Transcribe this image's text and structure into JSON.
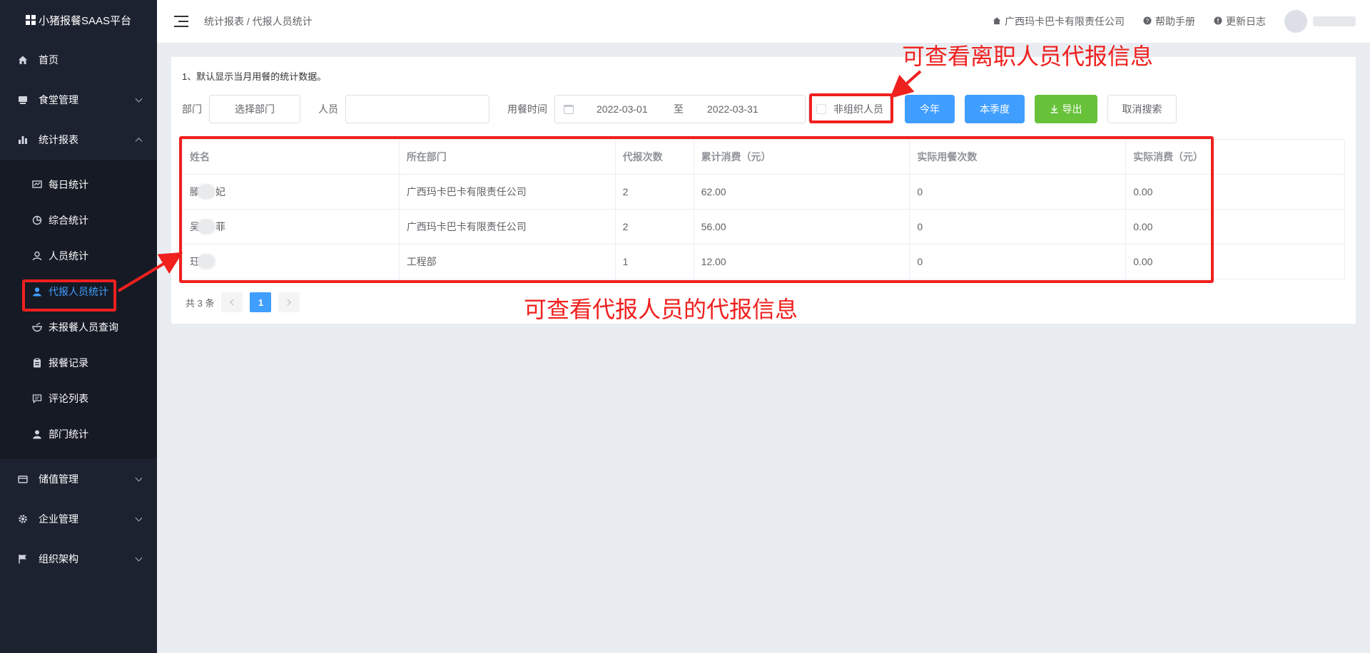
{
  "app": {
    "title": "小猪报餐SAAS平台"
  },
  "sidebar": {
    "items": [
      {
        "label": "首页",
        "icon": "home-icon"
      },
      {
        "label": "食堂管理",
        "icon": "canteen-icon"
      },
      {
        "label": "统计报表",
        "icon": "bar-chart-icon"
      }
    ],
    "sub_items": [
      {
        "label": "每日统计",
        "icon": "daily-stats-icon"
      },
      {
        "label": "综合统计",
        "icon": "pie-chart-icon"
      },
      {
        "label": "人员统计",
        "icon": "user-icon"
      },
      {
        "label": "代报人员统计",
        "icon": "user-filled-icon",
        "active": true
      },
      {
        "label": "未报餐人员查询",
        "icon": "bowl-icon"
      },
      {
        "label": "报餐记录",
        "icon": "clipboard-icon"
      },
      {
        "label": "评论列表",
        "icon": "comment-icon"
      },
      {
        "label": "部门统计",
        "icon": "user-group-icon"
      }
    ],
    "bottom_items": [
      {
        "label": "储值管理",
        "icon": "wallet-icon"
      },
      {
        "label": "企业管理",
        "icon": "gear-icon"
      },
      {
        "label": "组织架构",
        "icon": "flag-icon"
      }
    ]
  },
  "header": {
    "breadcrumb": "统计报表 / 代报人员统计",
    "company": "广西玛卡巴卡有限责任公司",
    "help": "帮助手册",
    "changelog": "更新日志"
  },
  "filters": {
    "tip": "1、默认显示当月用餐的统计数据。",
    "dept_label": "部门",
    "dept_button": "选择部门",
    "person_label": "人员",
    "person_value": "",
    "time_label": "用餐时间",
    "date_start": "2022-03-01",
    "date_sep": "至",
    "date_end": "2022-03-31",
    "checkbox_label": "非组织人员",
    "btn_year": "今年",
    "btn_quarter": "本季度",
    "btn_export": "导出",
    "btn_cancel": "取消搜索"
  },
  "table": {
    "headers": [
      "姓名",
      "所在部门",
      "代报次数",
      "累计消费（元）",
      "实际用餐次数",
      "实际消费（元）"
    ],
    "rows": [
      {
        "name_a": "滕",
        "name_b": "妃",
        "dept": "广西玛卡巴卡有限责任公司",
        "count": "2",
        "total": "62.00",
        "actual_count": "0",
        "actual_total": "0.00"
      },
      {
        "name_a": "吴",
        "name_b": "菲",
        "dept": "广西玛卡巴卡有限责任公司",
        "count": "2",
        "total": "56.00",
        "actual_count": "0",
        "actual_total": "0.00"
      },
      {
        "name_a": "玨",
        "name_b": "",
        "dept": "工程部",
        "count": "1",
        "total": "12.00",
        "actual_count": "0",
        "actual_total": "0.00"
      }
    ]
  },
  "pagination": {
    "total": "共 3 条",
    "current": "1"
  },
  "annotations": {
    "top": "可查看离职人员代报信息",
    "bottom": "可查看代报人员的代报信息",
    "color": "#f0201e"
  }
}
